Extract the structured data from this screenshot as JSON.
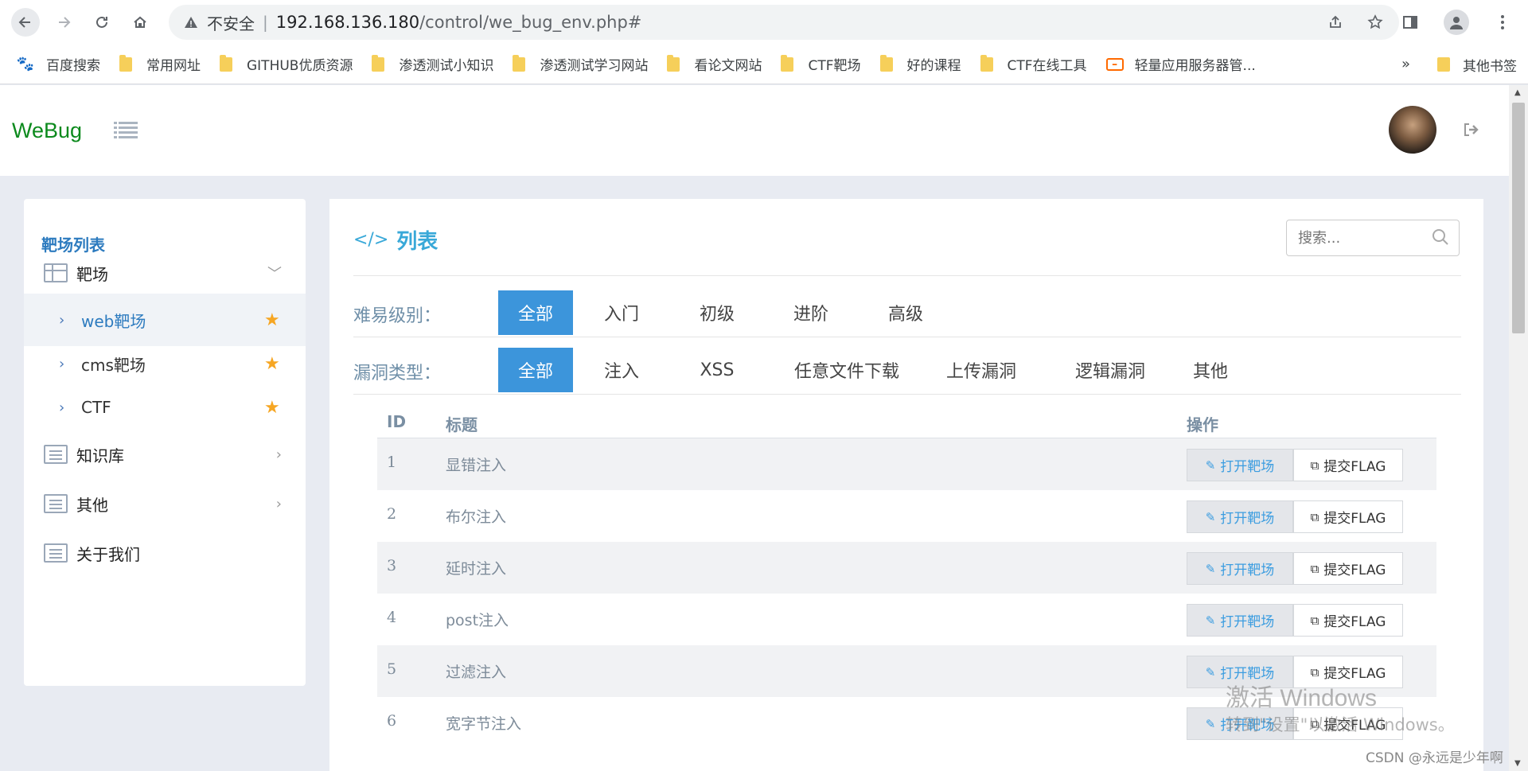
{
  "browser": {
    "insecure_label": "不安全",
    "url_host": "192.168.136.180",
    "url_path": "/control/we_bug_env.php#",
    "bookmarks": [
      {
        "icon": "baidu-icon",
        "label": "百度搜索"
      },
      {
        "icon": "folder-icon",
        "label": "常用网址"
      },
      {
        "icon": "folder-icon",
        "label": "GITHUB优质资源"
      },
      {
        "icon": "folder-icon",
        "label": "渗透测试小知识"
      },
      {
        "icon": "folder-icon",
        "label": "渗透测试学习网站"
      },
      {
        "icon": "folder-icon",
        "label": "看论文网站"
      },
      {
        "icon": "folder-icon",
        "label": "CTF靶场"
      },
      {
        "icon": "folder-icon",
        "label": "好的课程"
      },
      {
        "icon": "folder-icon",
        "label": "CTF在线工具"
      },
      {
        "icon": "aliyun-icon",
        "label": "轻量应用服务器管..."
      }
    ],
    "more_label": "»",
    "other_bookmarks": "其他书签"
  },
  "app": {
    "logo": "WeBug"
  },
  "sidebar": {
    "title": "靶场列表",
    "group": {
      "label": "靶场",
      "chevron": "﹀"
    },
    "subitems": [
      {
        "label": "web靶场",
        "active": true
      },
      {
        "label": "cms靶场",
        "active": false
      },
      {
        "label": "CTF",
        "active": false
      }
    ],
    "items": [
      {
        "label": "知识库",
        "chevron": "›"
      },
      {
        "label": "其他",
        "chevron": "›"
      },
      {
        "label": "关于我们",
        "chevron": ""
      }
    ]
  },
  "main": {
    "code_icon": "</>",
    "title": "列表",
    "search_placeholder": "搜索...",
    "difficulty": {
      "label": "难易级别：",
      "options": [
        "全部",
        "入门",
        "初级",
        "进阶",
        "高级"
      ],
      "selected": "全部"
    },
    "vuln_type": {
      "label": "漏洞类型：",
      "options": [
        "全部",
        "注入",
        "XSS",
        "任意文件下载",
        "上传漏洞",
        "逻辑漏洞",
        "其他"
      ],
      "selected": "全部"
    },
    "table": {
      "headers": {
        "id": "ID",
        "title": "标题",
        "action": "操作"
      },
      "open_label": "打开靶场",
      "flag_label": "提交FLAG",
      "rows": [
        {
          "id": "1",
          "title": "显错注入"
        },
        {
          "id": "2",
          "title": "布尔注入"
        },
        {
          "id": "3",
          "title": "延时注入"
        },
        {
          "id": "4",
          "title": "post注入"
        },
        {
          "id": "5",
          "title": "过滤注入"
        },
        {
          "id": "6",
          "title": "宽字节注入"
        }
      ]
    }
  },
  "overlay": {
    "watermark_title": "激活 Windows",
    "watermark_sub": "转到\"设置\"以激活 Windows。",
    "csdn": "CSDN @永远是少年啊"
  }
}
